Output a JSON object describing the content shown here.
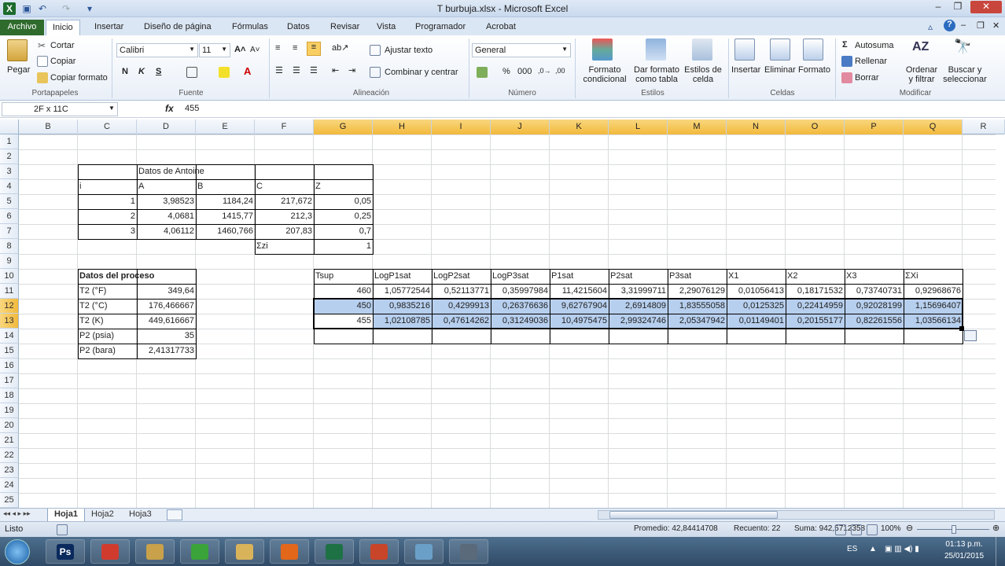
{
  "title": "T burbuja.xlsx - Microsoft Excel",
  "quick_access": [
    "save-icon",
    "undo-icon",
    "redo-icon"
  ],
  "tabs": [
    "Archivo",
    "Inicio",
    "Insertar",
    "Diseño de página",
    "Fórmulas",
    "Datos",
    "Revisar",
    "Vista",
    "Programador",
    "Acrobat"
  ],
  "ribbon": {
    "clipboard": {
      "paste": "Pegar",
      "cut": "Cortar",
      "copy": "Copiar",
      "format_painter": "Copiar formato",
      "group": "Portapapeles"
    },
    "font": {
      "name": "Calibri",
      "size": "11",
      "bold": "N",
      "italic": "K",
      "underline": "S",
      "group": "Fuente"
    },
    "alignment": {
      "wrap": "Ajustar texto",
      "merge": "Combinar y centrar",
      "group": "Alineación"
    },
    "number": {
      "format": "General",
      "percent": "%",
      "thousands": "000",
      "group": "Número"
    },
    "styles": {
      "conditional": [
        "Formato",
        "condicional"
      ],
      "table": [
        "Dar formato",
        "como tabla"
      ],
      "cell": [
        "Estilos de",
        "celda"
      ],
      "group": "Estilos"
    },
    "cells": {
      "insert": "Insertar",
      "delete": "Eliminar",
      "format": "Formato",
      "group": "Celdas"
    },
    "editing": {
      "autosum": "Autosuma",
      "fill": "Rellenar",
      "clear": "Borrar",
      "sort": [
        "Ordenar",
        "y filtrar"
      ],
      "find": [
        "Buscar y",
        "seleccionar"
      ],
      "group": "Modificar"
    }
  },
  "formula_bar": {
    "name_box": "2F x 11C",
    "fx": "fx",
    "value": "455"
  },
  "columns": [
    "B",
    "C",
    "D",
    "E",
    "F",
    "G",
    "H",
    "I",
    "J",
    "K",
    "L",
    "M",
    "N",
    "O",
    "P",
    "Q",
    "R"
  ],
  "rows": [
    "1",
    "2",
    "3",
    "4",
    "5",
    "6",
    "7",
    "8",
    "9",
    "10",
    "11",
    "12",
    "13",
    "14",
    "15",
    "16",
    "17",
    "18",
    "19",
    "20",
    "21",
    "22",
    "23",
    "24",
    "25"
  ],
  "cells": {
    "D3": "Datos de Antoine",
    "C4": "i",
    "D4": "A",
    "E4": "B",
    "F4": "C",
    "G4": "Z",
    "C5": "1",
    "D5": "3,98523",
    "E5": "1184,24",
    "F5": "217,672",
    "G5": "0,05",
    "C6": "2",
    "D6": "4,0681",
    "E6": "1415,77",
    "F6": "212,3",
    "G6": "0,25",
    "C7": "3",
    "D7": "4,06112",
    "E7": "1460,766",
    "F7": "207,83",
    "G7": "0,7",
    "F8": "Σzi",
    "G8": "1",
    "C10": "Datos del proceso",
    "C11": "T2 (°F)",
    "D11": "349,64",
    "C12": "T2 (°C)",
    "D12": "176,466667",
    "C13": "T2 (K)",
    "D13": "449,616667",
    "C14": "P2 (psia)",
    "D14": "35",
    "C15": "P2 (bara)",
    "D15": "2,41317733",
    "G10": "Tsup",
    "H10": "LogP1sat",
    "I10": "LogP2sat",
    "J10": "LogP3sat",
    "K10": "P1sat",
    "L10": "P2sat",
    "M10": "P3sat",
    "N10": "X1",
    "O10": "X2",
    "P10": "X3",
    "Q10": "ΣXi",
    "G11": "460",
    "H11": "1,05772544",
    "I11": "0,52113771",
    "J11": "0,35997984",
    "K11": "11,4215604",
    "L11": "3,31999711",
    "M11": "2,29076129",
    "N11": "0,01056413",
    "O11": "0,18171532",
    "P11": "0,73740731",
    "Q11": "0,92968676",
    "G12": "450",
    "H12": "0,9835216",
    "I12": "0,4299913",
    "J12": "0,26376636",
    "K12": "9,62767904",
    "L12": "2,6914809",
    "M12": "1,83555058",
    "N12": "0,0125325",
    "O12": "0,22414959",
    "P12": "0,92028199",
    "Q12": "1,15696407",
    "G13": "455",
    "H13": "1,02108785",
    "I13": "0,47614262",
    "J13": "0,31249036",
    "K13": "10,4975475",
    "L13": "2,99324746",
    "M13": "2,05347942",
    "N13": "0,01149401",
    "O13": "0,20155177",
    "P13": "0,82261556",
    "Q13": "1,03566134"
  },
  "sheets": [
    "Hoja1",
    "Hoja2",
    "Hoja3"
  ],
  "status": {
    "ready": "Listo",
    "average": "Promedio: 42,84414708",
    "count": "Recuento: 22",
    "sum": "Suma: 942,5712358",
    "zoom": "100%"
  },
  "taskbar": {
    "lang": "ES",
    "time": "01:13 p.m.",
    "date": "25/01/2015",
    "apps": [
      "Ps",
      "Chrome",
      "Explorer",
      "Sync",
      "Folder",
      "Firefox",
      "Excel",
      "PowerPoint",
      "Notepad",
      "Tool"
    ]
  },
  "colors": {
    "excel_green": "#2f6b2d",
    "selection": "#b7cfee",
    "header_highlight": "#f2b93b"
  }
}
